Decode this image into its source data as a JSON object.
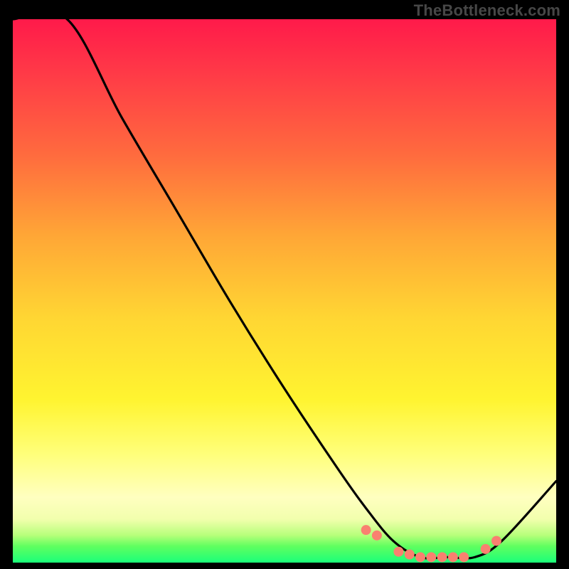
{
  "watermark": "TheBottleneck.com",
  "chart_data": {
    "type": "line",
    "title": "",
    "xlabel": "",
    "ylabel": "",
    "xlim": [
      0,
      100
    ],
    "ylim": [
      0,
      100
    ],
    "series": [
      {
        "name": "bottleneck-curve",
        "x": [
          0,
          10,
          20,
          30,
          40,
          50,
          60,
          65,
          70,
          75,
          80,
          85,
          90,
          100
        ],
        "y": [
          100,
          100,
          82,
          65,
          48,
          32,
          17,
          10,
          4,
          1,
          1,
          1,
          4,
          15
        ]
      }
    ],
    "markers": {
      "name": "highlight-dots",
      "x": [
        65,
        67,
        71,
        73,
        75,
        77,
        79,
        81,
        83,
        87,
        89
      ],
      "y": [
        6,
        5,
        2,
        1.5,
        1,
        1,
        1,
        1,
        1,
        2.5,
        4
      ],
      "color": "#f98070",
      "radius": 7
    },
    "gradient_stops": [
      {
        "pos": 0,
        "color": "#ff1a4a"
      },
      {
        "pos": 25,
        "color": "#ff6b3e"
      },
      {
        "pos": 55,
        "color": "#ffd633"
      },
      {
        "pos": 80,
        "color": "#ffff7a"
      },
      {
        "pos": 95,
        "color": "#b6ff7a"
      },
      {
        "pos": 100,
        "color": "#1aff7a"
      }
    ]
  }
}
